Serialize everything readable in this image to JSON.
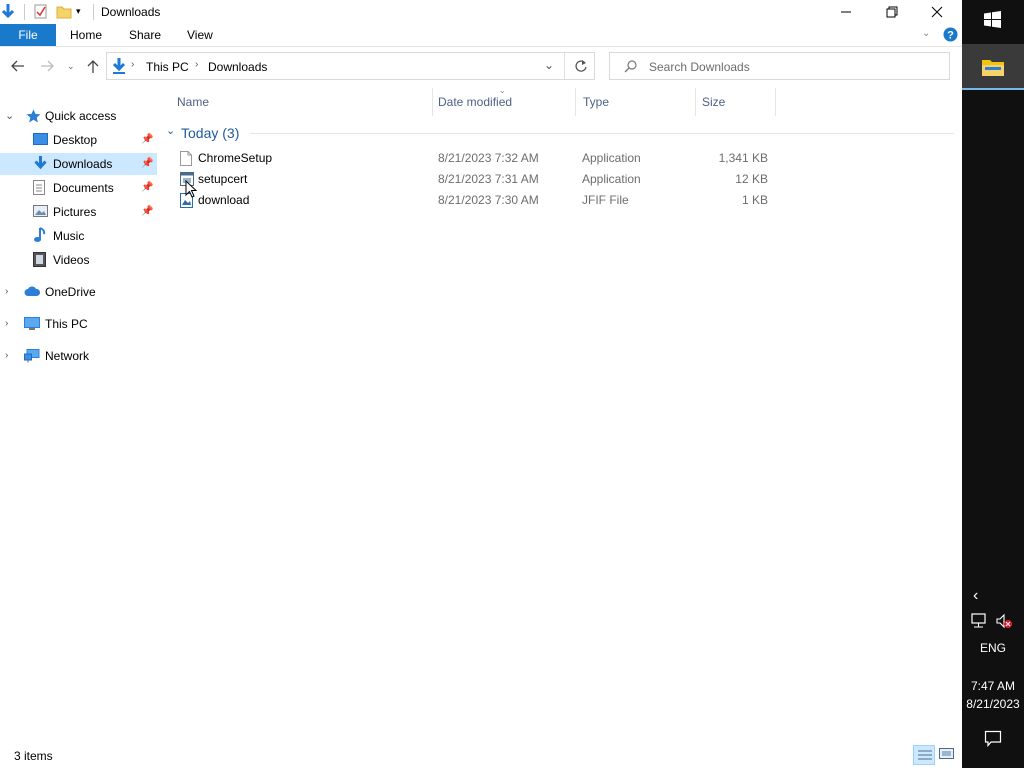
{
  "window": {
    "title": "Downloads"
  },
  "ribbon": {
    "file": "File",
    "home": "Home",
    "share": "Share",
    "view": "View"
  },
  "address": {
    "root": "This PC",
    "current": "Downloads"
  },
  "search": {
    "placeholder": "Search Downloads"
  },
  "nav": {
    "quick_access": "Quick access",
    "items": [
      {
        "label": "Desktop",
        "pinned": true
      },
      {
        "label": "Downloads",
        "pinned": true,
        "selected": true
      },
      {
        "label": "Documents",
        "pinned": true
      },
      {
        "label": "Pictures",
        "pinned": true
      },
      {
        "label": "Music",
        "pinned": false
      },
      {
        "label": "Videos",
        "pinned": false
      }
    ],
    "onedrive": "OneDrive",
    "this_pc": "This PC",
    "network": "Network"
  },
  "columns": {
    "name": "Name",
    "date": "Date modified",
    "type": "Type",
    "size": "Size"
  },
  "group": {
    "label": "Today (3)"
  },
  "files": [
    {
      "name": "ChromeSetup",
      "date": "8/21/2023 7:32 AM",
      "type": "Application",
      "size": "1,341 KB"
    },
    {
      "name": "setupcert",
      "date": "8/21/2023 7:31 AM",
      "type": "Application",
      "size": "12 KB"
    },
    {
      "name": "download",
      "date": "8/21/2023 7:30 AM",
      "type": "JFIF File",
      "size": "1 KB"
    }
  ],
  "status": {
    "items": "3 items"
  },
  "taskbar": {
    "lang": "ENG",
    "time": "7:47 AM",
    "date": "8/21/2023"
  },
  "colors": {
    "accent": "#1979ca",
    "selection": "#cce8ff",
    "taskbar": "#101010"
  }
}
